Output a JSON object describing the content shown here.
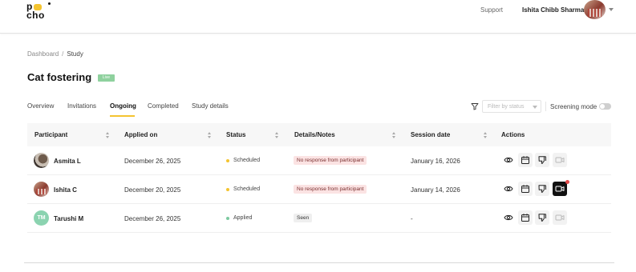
{
  "header": {
    "logo": {
      "line1": "p",
      "line2": "cho"
    },
    "support": "Support",
    "user_name": "Ishita Chibb Sharma"
  },
  "breadcrumb": {
    "root": "Dashboard",
    "separator": "/",
    "current": "Study"
  },
  "study": {
    "title": "Cat fostering",
    "badge": "Live"
  },
  "tabs": [
    {
      "label": "Overview",
      "active": false
    },
    {
      "label": "Invitations",
      "active": false
    },
    {
      "label": "Ongoing",
      "active": true
    },
    {
      "label": "Completed",
      "active": false
    },
    {
      "label": "Study details",
      "active": false
    }
  ],
  "filter": {
    "placeholder": "Filter by status"
  },
  "screening": {
    "label": "Screening mode",
    "enabled": false
  },
  "table": {
    "headers": [
      "Participant",
      "Applied on",
      "Status",
      "Details/Notes",
      "Session date",
      "Actions"
    ],
    "rows": [
      {
        "participant": "Asmita L",
        "applied_on": "December 26, 2025",
        "status": "Scheduled",
        "status_color": "#f4c430",
        "note": "No response from participant",
        "note_style": "red",
        "session_date": "January 16, 2026",
        "video_active": false
      },
      {
        "participant": "Ishita C",
        "applied_on": "December 20, 2025",
        "status": "Scheduled",
        "status_color": "#f4c430",
        "note": "No response from participant",
        "note_style": "red",
        "session_date": "January 14, 2026",
        "video_active": true
      },
      {
        "participant": "Tarushi M",
        "initials": "TM",
        "applied_on": "December 26, 2025",
        "status": "Applied",
        "status_color": "#7cc9a0",
        "note": "Seen",
        "note_style": "grey",
        "session_date": "-",
        "video_active": false
      }
    ]
  },
  "colors": {
    "accent": "#f4c430",
    "live": "#8fd19e",
    "danger": "#e24a4a"
  }
}
